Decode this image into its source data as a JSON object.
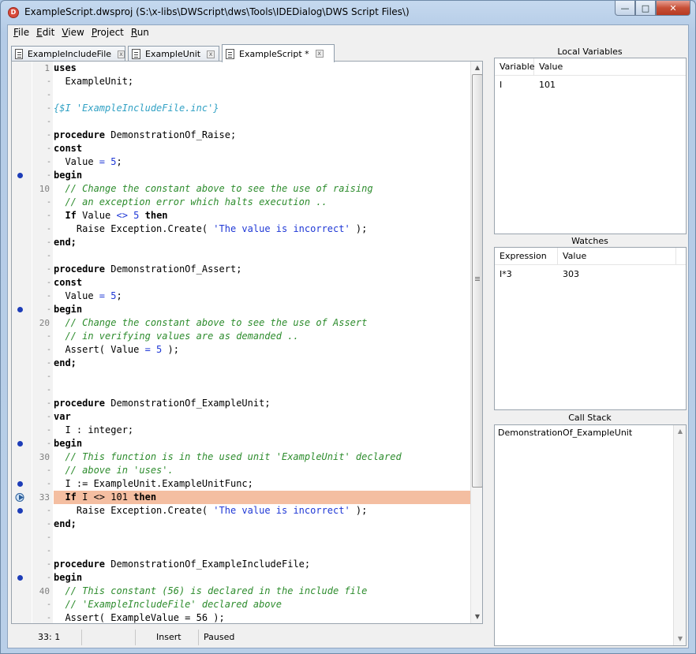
{
  "window": {
    "title": "ExampleScript.dwsproj  (S:\\x-libs\\DWScript\\dws\\Tools\\IDEDialog\\DWS Script Files\\)",
    "app_icon_letter": "D",
    "minimize_glyph": "—",
    "maximize_glyph": "□",
    "close_glyph": "✕"
  },
  "menu": {
    "file": {
      "hotkey": "F",
      "rest": "ile"
    },
    "edit": {
      "hotkey": "E",
      "rest": "dit"
    },
    "view": {
      "hotkey": "V",
      "rest": "iew"
    },
    "project": {
      "hotkey": "P",
      "rest": "roject"
    },
    "run": {
      "hotkey": "R",
      "rest": "un"
    }
  },
  "tabs": [
    {
      "label": "ExampleIncludeFile",
      "close": "x",
      "icon": "document-icon"
    },
    {
      "label": "ExampleUnit",
      "close": "x",
      "icon": "document-icon"
    },
    {
      "label": "ExampleScript *",
      "close": "x",
      "icon": "document-icon",
      "active": true
    }
  ],
  "editor": {
    "current_line": 33,
    "lines": [
      {
        "n": "1",
        "bp": false
      },
      {
        "n": "",
        "bp": false
      },
      {
        "n": "",
        "bp": false
      },
      {
        "n": "",
        "bp": false
      },
      {
        "n": "",
        "bp": false
      },
      {
        "n": "",
        "bp": false
      },
      {
        "n": "",
        "bp": false
      },
      {
        "n": "",
        "bp": false
      },
      {
        "n": "",
        "bp": true
      },
      {
        "n": "10",
        "bp": false
      },
      {
        "n": "",
        "bp": false
      },
      {
        "n": "",
        "bp": false
      },
      {
        "n": "",
        "bp": false
      },
      {
        "n": "",
        "bp": false
      },
      {
        "n": "",
        "bp": false
      },
      {
        "n": "",
        "bp": false
      },
      {
        "n": "",
        "bp": false
      },
      {
        "n": "",
        "bp": false
      },
      {
        "n": "",
        "bp": true
      },
      {
        "n": "20",
        "bp": false
      },
      {
        "n": "",
        "bp": false
      },
      {
        "n": "",
        "bp": false
      },
      {
        "n": "",
        "bp": false
      },
      {
        "n": "",
        "bp": false
      },
      {
        "n": "",
        "bp": false
      },
      {
        "n": "",
        "bp": false
      },
      {
        "n": "",
        "bp": false
      },
      {
        "n": "",
        "bp": false
      },
      {
        "n": "",
        "bp": true
      },
      {
        "n": "30",
        "bp": false
      },
      {
        "n": "",
        "bp": false
      },
      {
        "n": "",
        "bp": true
      },
      {
        "n": "33",
        "bp": false,
        "exec": true,
        "hl": true
      },
      {
        "n": "",
        "bp": true
      },
      {
        "n": "",
        "bp": false
      },
      {
        "n": "",
        "bp": false
      },
      {
        "n": "",
        "bp": false
      },
      {
        "n": "",
        "bp": false
      },
      {
        "n": "",
        "bp": true
      },
      {
        "n": "40",
        "bp": false
      },
      {
        "n": "",
        "bp": false
      },
      {
        "n": "",
        "bp": false
      }
    ]
  },
  "code": {
    "l1": "uses",
    "l2": "  ExampleUnit;",
    "l4": "{$I 'ExampleIncludeFile.inc'}",
    "l6_kw": "procedure",
    "l6": " DemonstrationOf_Raise;",
    "l7": "const",
    "l8a": "  Value ",
    "l8op": "=",
    "l8num": " 5",
    "l8b": ";",
    "l9": "begin",
    "l10": "  // Change the constant above to see the use of raising",
    "l11": "  // an exception error which halts execution ..",
    "l12_kw": "  If",
    "l12a": " Value ",
    "l12op": "<>",
    "l12num": " 5",
    "l12_kw2": " then",
    "l13a": "    Raise Exception.Create( ",
    "l13str": "'The value is incorrect'",
    "l13b": " );",
    "l14": "end;",
    "l16_kw": "procedure",
    "l16": " DemonstrationOf_Assert;",
    "l17": "const",
    "l18a": "  Value ",
    "l18op": "=",
    "l18num": " 5",
    "l18b": ";",
    "l19": "begin",
    "l20": "  // Change the constant above to see the use of Assert",
    "l21": "  // in verifying values are as demanded ..",
    "l22a": "  Assert( Value ",
    "l22op": "=",
    "l22num": " 5",
    "l22b": " );",
    "l23": "end;",
    "l26_kw": "procedure",
    "l26": " DemonstrationOf_ExampleUnit;",
    "l27": "var",
    "l28": "  I : integer;",
    "l29": "begin",
    "l30": "  // This function is in the used unit 'ExampleUnit' declared",
    "l31": "  // above in 'uses'.",
    "l32": "  I := ExampleUnit.ExampleUnitFunc;",
    "l33_kw": "  If",
    "l33a": " I <> 101 ",
    "l33_kw2": "then",
    "l34a": "    Raise Exception.Create( ",
    "l34str": "'The value is incorrect'",
    "l34b": " );",
    "l35": "end;",
    "l38_kw": "procedure",
    "l38": " DemonstrationOf_ExampleIncludeFile;",
    "l39": "begin",
    "l40": "  // This constant (56) is declared in the include file",
    "l41": "  // 'ExampleIncludeFile' declared above",
    "l42": "  Assert( ExampleValue = 56 );"
  },
  "status": {
    "position": "33: 1",
    "mode": "Insert",
    "state": "Paused"
  },
  "local_variables": {
    "title": "Local Variables",
    "col_variable": "Variable",
    "col_value": "Value",
    "rows": [
      {
        "variable": "I",
        "value": "101"
      }
    ]
  },
  "watches": {
    "title": "Watches",
    "col_expression": "Expression",
    "col_value": "Value",
    "rows": [
      {
        "expression": "I*3",
        "value": "303"
      }
    ]
  },
  "call_stack": {
    "title": "Call Stack",
    "items": [
      "DemonstrationOf_ExampleUnit"
    ]
  },
  "colors": {
    "highlight_line": "#f4bea1",
    "breakpoint": "#1d3db8",
    "comment": "#2d8c2d",
    "directive": "#31a1c4",
    "string": "#1f38d6"
  },
  "icons": {
    "breakpoint": "breakpoint-dot-icon",
    "execution_point": "execution-arrow-icon"
  }
}
